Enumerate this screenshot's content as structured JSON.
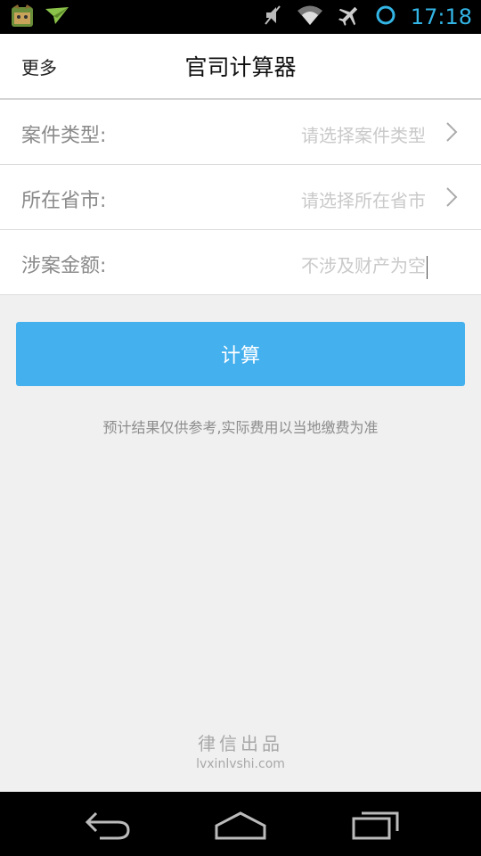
{
  "status_bar": {
    "time": "17:18",
    "icons": [
      "app-notification-icon",
      "send-notification-icon",
      "mute-icon",
      "wifi-icon",
      "airplane-icon",
      "loading-ring-icon"
    ],
    "accent_color": "#33b5e5"
  },
  "header": {
    "more_label": "更多",
    "title": "官司计算器"
  },
  "form": {
    "rows": [
      {
        "label": "案件类型:",
        "placeholder": "请选择案件类型"
      },
      {
        "label": "所在省市:",
        "placeholder": "请选择所在省市"
      },
      {
        "label": "涉案金额:",
        "placeholder": "不涉及财产为空"
      }
    ]
  },
  "calculate_button": {
    "label": "计算",
    "color": "#45b0ee"
  },
  "disclaimer": "预计结果仅供参考,实际费用以当地缴费为准",
  "footer": {
    "brand_name": "律信出品",
    "brand_url": "lvxinlvshi.com"
  },
  "nav_bar": {
    "buttons": [
      "back-icon",
      "home-icon",
      "recent-apps-icon"
    ]
  }
}
